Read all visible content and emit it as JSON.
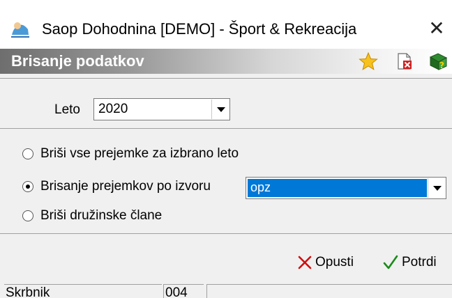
{
  "window": {
    "title": "Saop Dohodnina [DEMO] - Šport & Rekreacija",
    "close_glyph": "✕"
  },
  "header": {
    "title": "Brisanje podatkov",
    "icons": [
      "star-icon",
      "delete-document-icon",
      "help-book-icon"
    ]
  },
  "year": {
    "label": "Leto",
    "value": "2020"
  },
  "options": [
    {
      "label": "Briši vse prejemke za izbrano leto",
      "checked": false
    },
    {
      "label": "Brisanje prejemkov po izvoru",
      "checked": true
    },
    {
      "label": "Briši družinske člane",
      "checked": false
    }
  ],
  "source": {
    "value": "opz"
  },
  "actions": {
    "cancel_label": "Opusti",
    "confirm_label": "Potrdi"
  },
  "status": {
    "cell1": "Skrbnik",
    "cell2": "004",
    "cell3": ""
  },
  "colors": {
    "selection": "#0078d7",
    "cancel_x": "#d01010",
    "confirm_check": "#1a8a1a"
  }
}
